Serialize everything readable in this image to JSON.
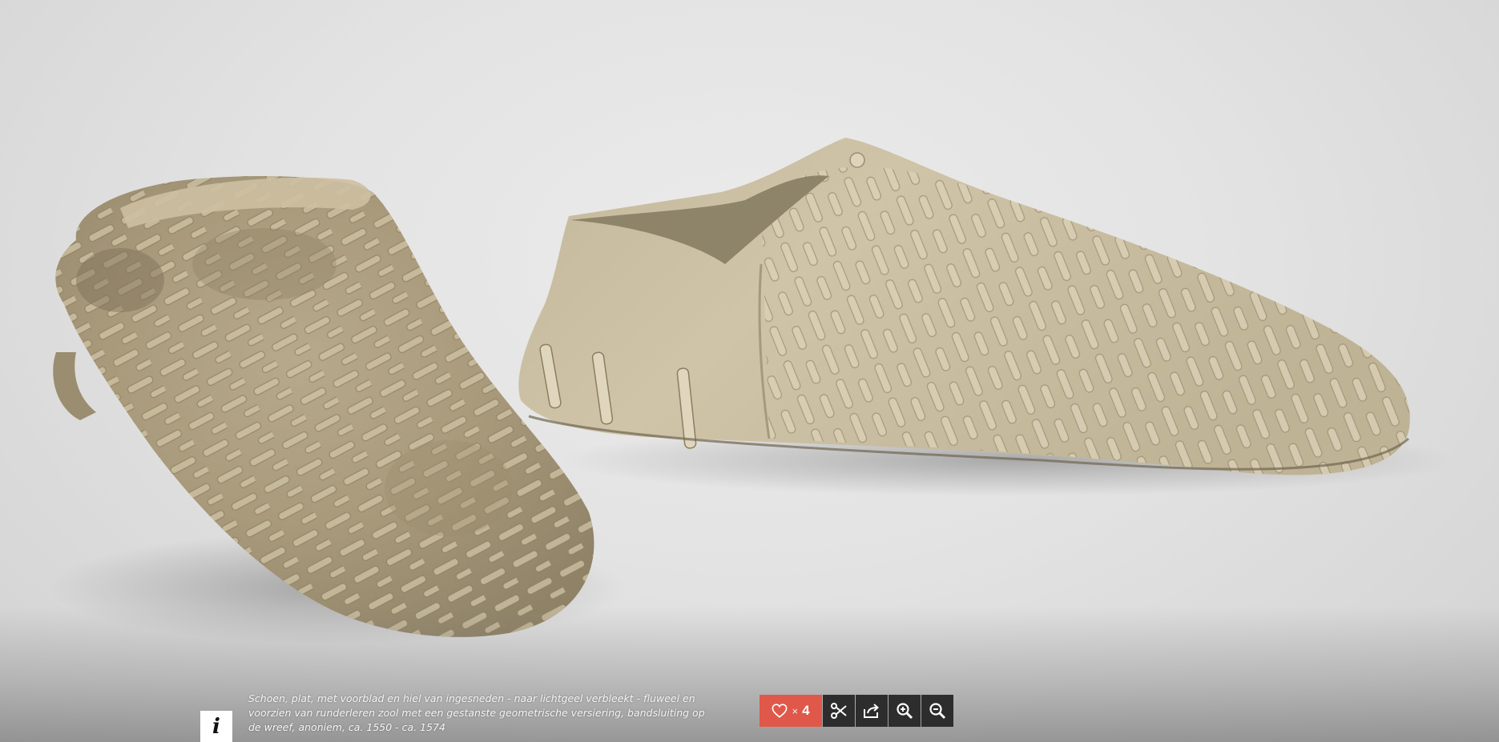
{
  "artwork": {
    "caption": "Schoen, plat, met voorblad en hiel van ingesneden - naar lichtgeel verbleekt - fluweel en voorzien van runderleren zool met een gestanste geometrische versiering, bandsluiting op de wreef, anoniem, ca. 1550 - ca. 1574",
    "info_icon": "i"
  },
  "toolbar": {
    "like_times": "×",
    "like_count": "4",
    "icons": [
      "heart-icon",
      "scissors-icon",
      "share-icon",
      "zoom-in-icon",
      "zoom-out-icon"
    ]
  },
  "colors": {
    "like_bg": "#e0584a",
    "tool_bg": "#2d2d2d",
    "background": "#e3e3e3",
    "shoe": "#bfb296"
  }
}
